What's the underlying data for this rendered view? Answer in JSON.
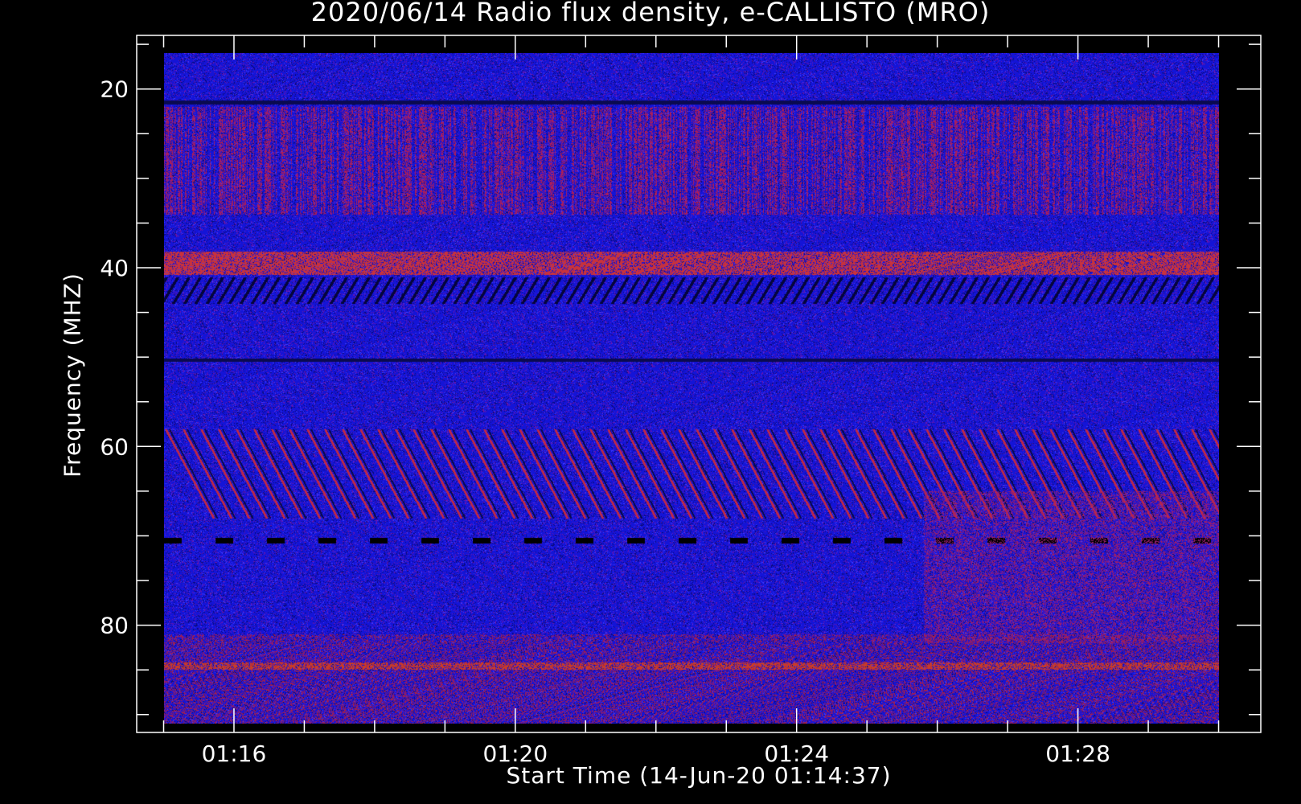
{
  "chart_data": {
    "type": "heatmap",
    "title": "2020/06/14  Radio flux density, e-CALLISTO (MRO)",
    "xlabel": "Start Time (14-Jun-20 01:14:37)",
    "ylabel": "Frequency (MHZ)",
    "x_tick_labels": [
      "01:16",
      "01:20",
      "01:24",
      "01:28"
    ],
    "x_tick_minutes": [
      76,
      80,
      84,
      88
    ],
    "x_range_minutes": [
      74.617,
      90.6
    ],
    "x_data_range_minutes": [
      75.0,
      90.0
    ],
    "y_tick_labels": [
      "20",
      "40",
      "60",
      "80"
    ],
    "y_tick_values": [
      20,
      40,
      60,
      80
    ],
    "y_range": [
      14,
      92
    ],
    "y_data_range": [
      16,
      91
    ],
    "y_inverted": true,
    "colors": {
      "background": "#000000",
      "low": "#0a0a9a",
      "mid": "#2a2aff",
      "high": "#c42222",
      "axis": "#ffffff"
    },
    "features": [
      {
        "label": "bright band",
        "freq_mhz": 39.5
      },
      {
        "label": "dark drifting band",
        "freq_mhz": 42.5
      },
      {
        "label": "drifting bursts",
        "freq_mhz_range": [
          58,
          68
        ]
      },
      {
        "label": "dashed dark line",
        "freq_mhz": 70.5
      }
    ]
  }
}
